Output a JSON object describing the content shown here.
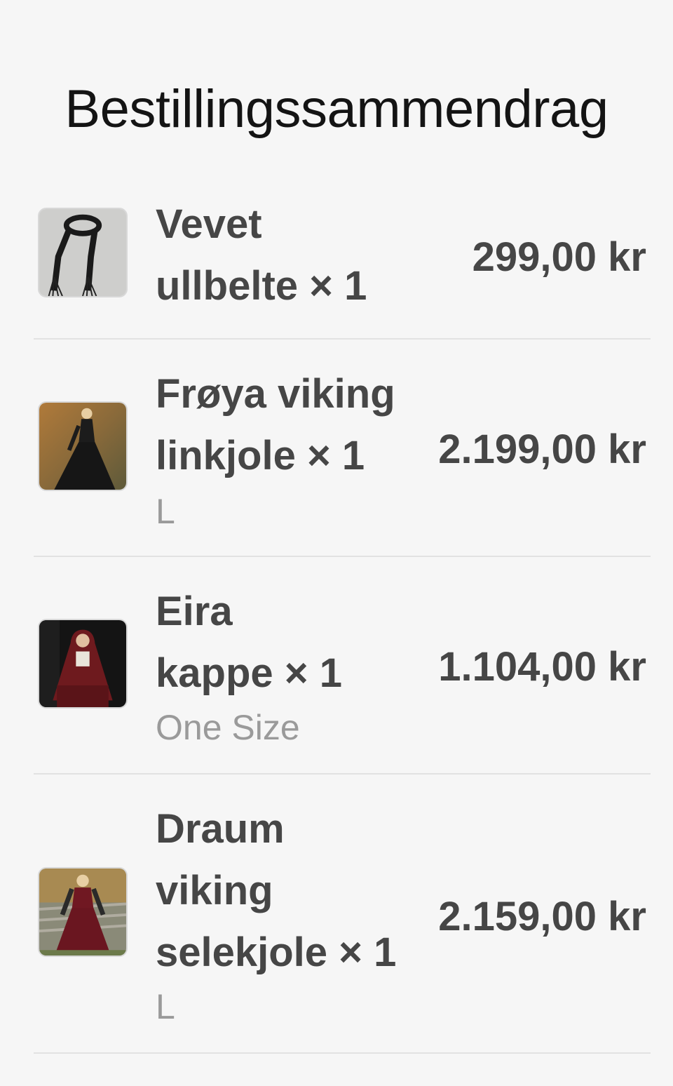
{
  "page": {
    "title": "Bestillingssammendrag"
  },
  "items": [
    {
      "name_line1": "Vevet",
      "name_line2": "ullbelte × 1",
      "name_line3": "",
      "variant": "",
      "price": "299,00 kr"
    },
    {
      "name_line1": "Frøya viking",
      "name_line2": "linkjole × 1",
      "name_line3": "",
      "variant": "L",
      "price": "2.199,00 kr"
    },
    {
      "name_line1": "Eira",
      "name_line2": "kappe × 1",
      "name_line3": "",
      "variant": "One Size",
      "price": "1.104,00 kr"
    },
    {
      "name_line1": "Draum",
      "name_line2": "viking",
      "name_line3": "selekjole × 1",
      "variant": "L",
      "price": "2.159,00 kr"
    }
  ],
  "colors": {
    "background": "#f6f6f6",
    "text_primary": "#141414",
    "text_item": "#464646",
    "text_variant": "#9a9a9a",
    "divider": "#e2e2e2"
  }
}
